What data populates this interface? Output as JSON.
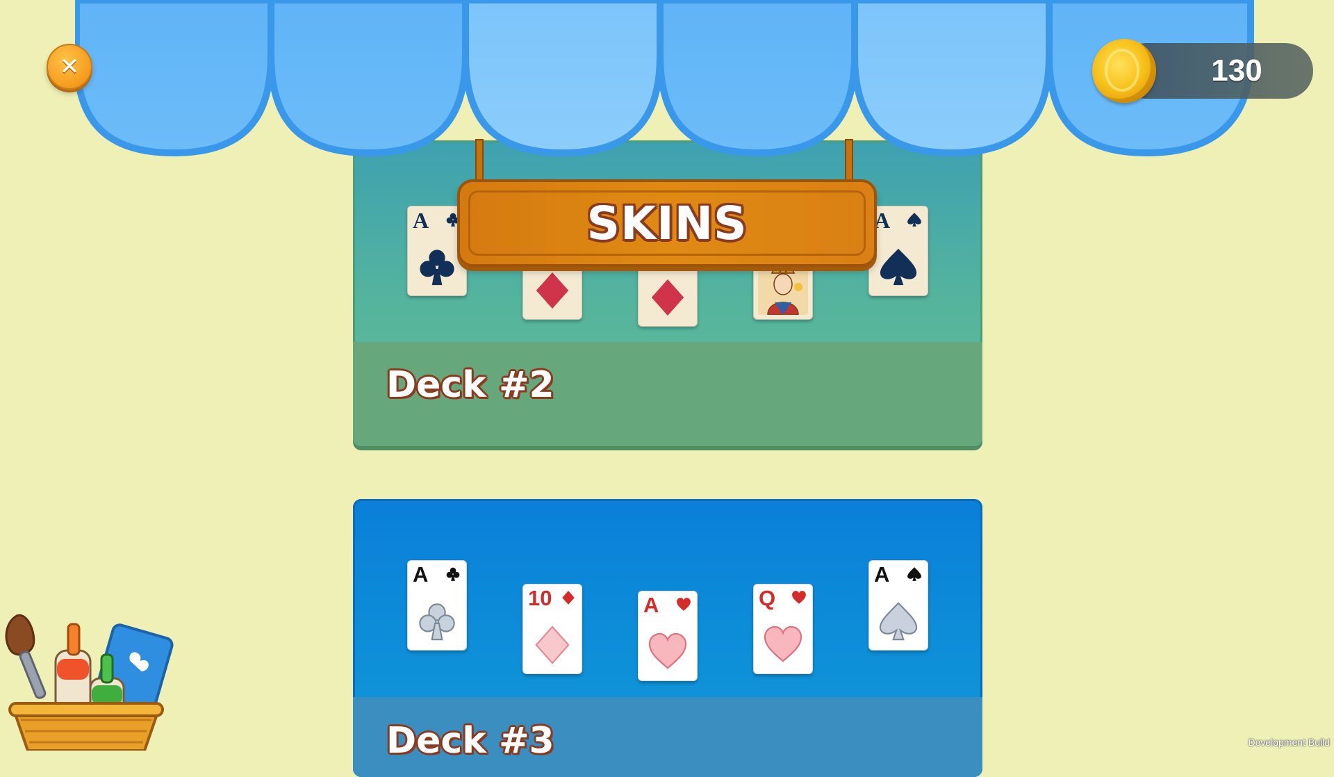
{
  "header": {
    "title": "SKINS",
    "coins": "130"
  },
  "decks": [
    {
      "name": "Deck #2",
      "cards": [
        {
          "rank": "A",
          "suit": "clubs",
          "color": "#123057"
        },
        {
          "rank": "",
          "suit": "diamonds",
          "color": "#d42b2b"
        },
        {
          "rank": "",
          "suit": "diamonds",
          "color": "#d42b2b"
        },
        {
          "rank": "",
          "suit": "queen-face",
          "color": "#d42b2b"
        },
        {
          "rank": "A",
          "suit": "spades",
          "color": "#123057"
        }
      ]
    },
    {
      "name": "Deck #3",
      "cards": [
        {
          "rank": "A",
          "suit": "clubs",
          "color": "#111111"
        },
        {
          "rank": "10",
          "suit": "diamonds",
          "color": "#d42b2b"
        },
        {
          "rank": "A",
          "suit": "hearts",
          "color": "#d42b2b"
        },
        {
          "rank": "Q",
          "suit": "hearts",
          "color": "#d42b2b"
        },
        {
          "rank": "A",
          "suit": "spades",
          "color": "#111111"
        }
      ]
    }
  ],
  "icons": {
    "close": "close-icon",
    "coin": "coin-icon",
    "paint_bucket": "paint-bucket-icon"
  },
  "colors": {
    "background": "#eef0b6",
    "awning": "#5fb4f7",
    "sign": "#dd8412",
    "deck2_bg": "#55b59c",
    "deck3_bg": "#0e90d8"
  },
  "footer": {
    "build_label": "Development Build"
  }
}
